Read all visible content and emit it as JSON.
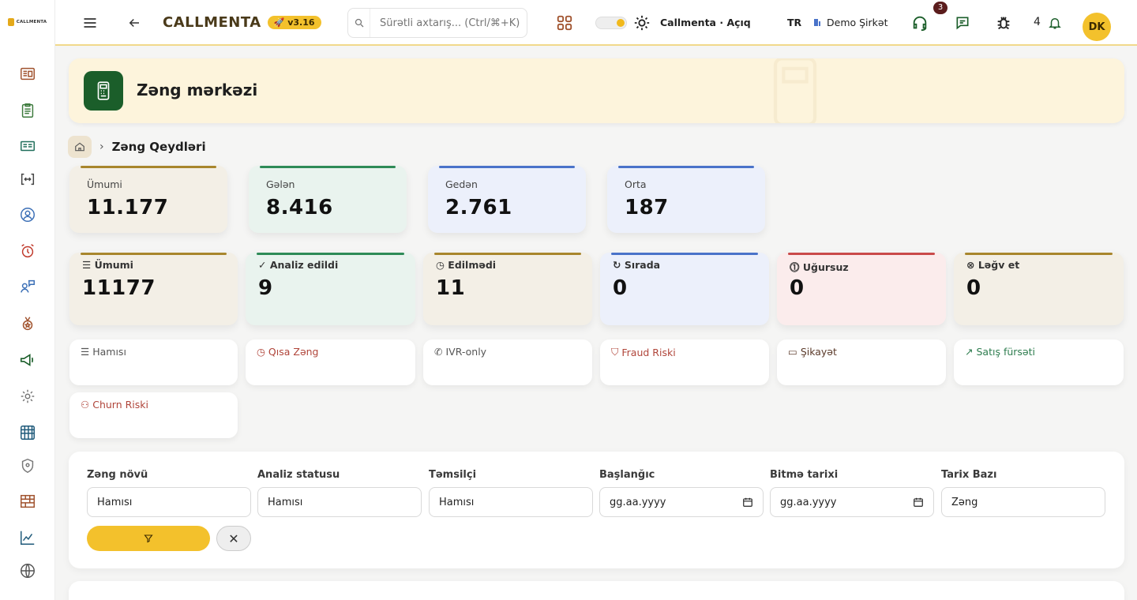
{
  "sidebar": {
    "logo_text": "CALLMENTA",
    "items": [
      {
        "icon": "dashboard-icon"
      },
      {
        "icon": "clipboard-icon"
      },
      {
        "icon": "analytics-board-icon"
      },
      {
        "icon": "code-brackets-icon"
      },
      {
        "icon": "user-circle-icon"
      },
      {
        "icon": "alarm-icon"
      },
      {
        "icon": "user-chat-icon"
      },
      {
        "icon": "medal-icon"
      },
      {
        "icon": "megaphone-icon"
      },
      {
        "icon": "settings-icon"
      },
      {
        "icon": "grid-calendar-icon"
      },
      {
        "icon": "shield-icon"
      },
      {
        "icon": "bricks-icon"
      },
      {
        "icon": "line-chart-icon"
      },
      {
        "icon": "globe-icon"
      }
    ]
  },
  "topbar": {
    "brand": "CALLMENTA",
    "version": "v3.16",
    "search_placeholder": "Sürətli axtarış... (Ctrl/⌘+K)",
    "env_label": "Callmenta · Açıq",
    "lang": "TR",
    "company": "Demo Şirkət",
    "support_badge": "3",
    "notif_count": "4",
    "avatar": "DK"
  },
  "hero": {
    "title": "Zəng mərkəzi"
  },
  "breadcrumb": {
    "current": "Zəng Qeydləri"
  },
  "summary": [
    {
      "label": "Ümumi",
      "value": "11.177",
      "accent": "#a8862d",
      "bg": "#f3efe6"
    },
    {
      "label": "Gələn",
      "value": "8.416",
      "accent": "#2e8b57",
      "bg": "#e9f3ee"
    },
    {
      "label": "Gedən",
      "value": "2.761",
      "accent": "#4a73c9",
      "bg": "#ecf0fb"
    },
    {
      "label": "Orta",
      "value": "187",
      "accent": "#4a73c9",
      "bg": "#ecf0fb"
    }
  ],
  "status": [
    {
      "label": "Ümumi",
      "value": "11177",
      "icon": "list-icon",
      "accent": "#a8862d",
      "bg": "#f3efe6"
    },
    {
      "label": "Analiz edildi",
      "value": "9",
      "icon": "check-icon",
      "accent": "#2e8b57",
      "bg": "#e9f3ee"
    },
    {
      "label": "Edilmədi",
      "value": "11",
      "icon": "clock-icon",
      "accent": "#a8862d",
      "bg": "#f3efe6"
    },
    {
      "label": "Sırada",
      "value": "0",
      "icon": "spinner-icon",
      "accent": "#4a73c9",
      "bg": "#ecf0fb"
    },
    {
      "label": "Uğursuz",
      "value": "0",
      "icon": "alert-circle-icon",
      "accent": "#c94a4a",
      "bg": "#fbecec"
    },
    {
      "label": "Ləğv et",
      "value": "0",
      "icon": "cancel-circle-icon",
      "accent": "#a8862d",
      "bg": "#f3efe6"
    }
  ],
  "chips": [
    {
      "label": "Hamısı",
      "icon": "list-icon",
      "color": "#555555"
    },
    {
      "label": "Qısa Zəng",
      "icon": "clock-icon",
      "color": "#b0453a"
    },
    {
      "label": "IVR-only",
      "icon": "phone-off-icon",
      "color": "#555555"
    },
    {
      "label": "Fraud Riski",
      "icon": "shield-alert-icon",
      "color": "#b0453a"
    },
    {
      "label": "Şikayət",
      "icon": "message-icon",
      "color": "#5b3a2a"
    },
    {
      "label": "Satış fürsəti",
      "icon": "trending-up-icon",
      "color": "#2e7d4f"
    },
    {
      "label": "Churn Riski",
      "icon": "user-minus-icon",
      "color": "#b0453a"
    }
  ],
  "filters": [
    {
      "label": "Zəng növü",
      "value": "Hamısı",
      "type": "select"
    },
    {
      "label": "Analiz statusu",
      "value": "Hamısı",
      "type": "select"
    },
    {
      "label": "Təmsilçi",
      "value": "Hamısı",
      "type": "select"
    },
    {
      "label": "Başlanğıc",
      "value": "gg.aa.yyyy",
      "type": "date"
    },
    {
      "label": "Bitmə tarixi",
      "value": "gg.aa.yyyy",
      "type": "date"
    },
    {
      "label": "Tarix Bazı",
      "value": "Zəng",
      "type": "select"
    }
  ],
  "colors": {
    "accent": "#f3c12c",
    "hero_bg": "#fdf4dc",
    "hero_icon": "#1b5e2a"
  }
}
